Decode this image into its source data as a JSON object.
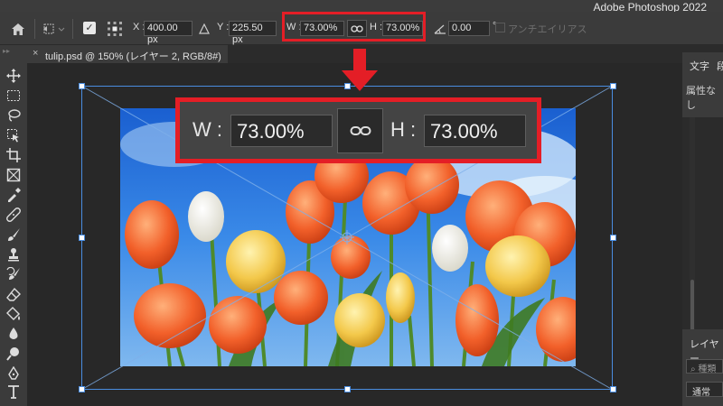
{
  "app": {
    "title": "Adobe Photoshop 2022"
  },
  "options_bar": {
    "x_label": "X :",
    "x_value": "400.00 px",
    "y_label": "Y :",
    "y_value": "225.50 px",
    "w_label": "W :",
    "w_value": "73.00%",
    "h_label": "H :",
    "h_value": "73.00%",
    "angle_value": "0.00",
    "angle_unit": "°",
    "antialias_label": "アンチエイリアス"
  },
  "document_tab": {
    "title": "tulip.psd @ 150% (レイヤー 2, RGB/8#)"
  },
  "right_panels": {
    "top_tab_1": "文字",
    "top_tab_2": "段",
    "properties_text": "属性なし",
    "layers_tab": "レイヤー",
    "search_placeholder": "種類",
    "blend_mode": "通常"
  },
  "zoom_callout": {
    "w_label": "W :",
    "w_value": "73.00%",
    "h_label": "H :",
    "h_value": "73.00%"
  },
  "colors": {
    "highlight": "#e41e26",
    "selection": "#4a8de0"
  }
}
